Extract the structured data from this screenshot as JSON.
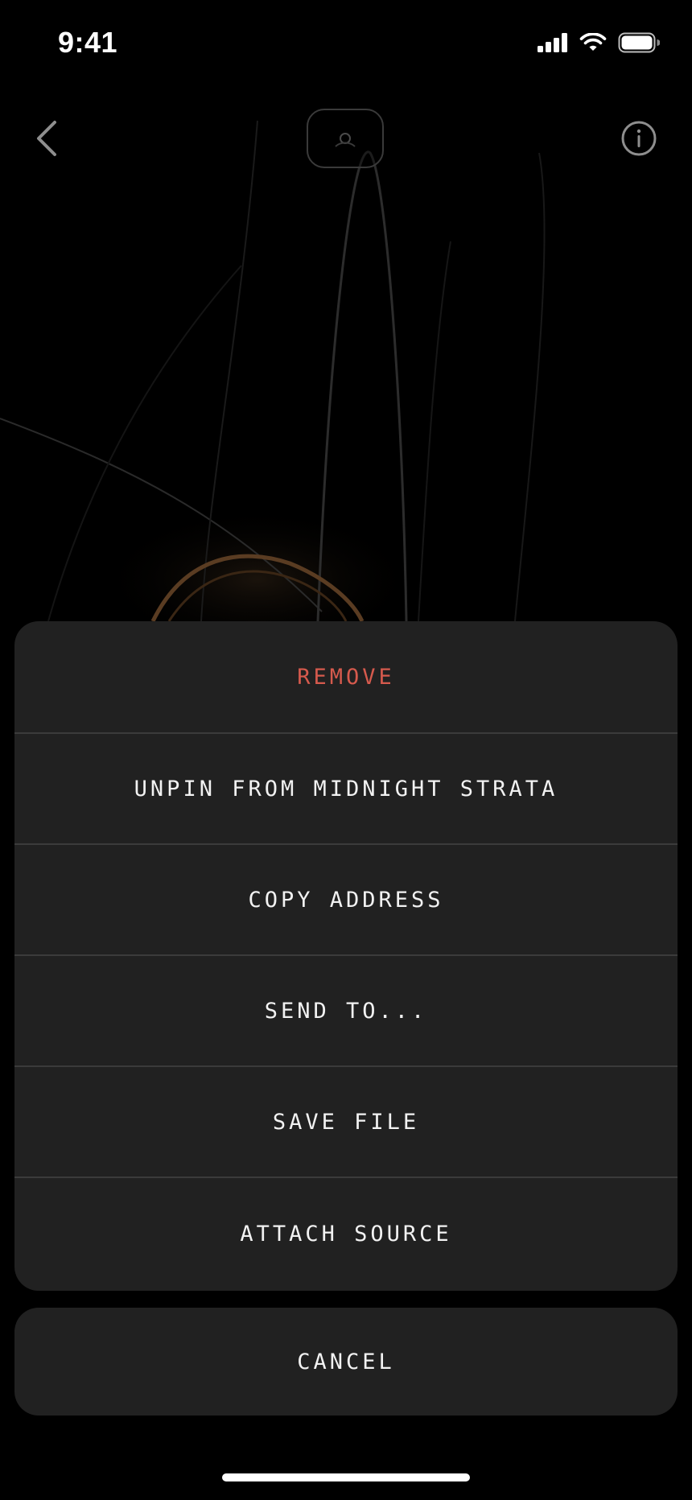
{
  "status_bar": {
    "time": "9:41"
  },
  "nav": {
    "back_icon": "chevron-left-icon",
    "center_icon": "media-thumbnail-icon",
    "info_icon": "info-icon"
  },
  "action_sheet": {
    "items": [
      {
        "label": "REMOVE",
        "style": "destructive"
      },
      {
        "label": "UNPIN FROM MIDNIGHT STRATA",
        "style": "default"
      },
      {
        "label": "COPY ADDRESS",
        "style": "default"
      },
      {
        "label": "SEND TO...",
        "style": "default"
      },
      {
        "label": "SAVE FILE",
        "style": "default"
      },
      {
        "label": "ATTACH SOURCE",
        "style": "default"
      }
    ],
    "cancel_label": "CANCEL"
  },
  "colors": {
    "destructive": "#d65a4d",
    "sheet_bg": "#212121",
    "divider": "#3b3b3b"
  }
}
